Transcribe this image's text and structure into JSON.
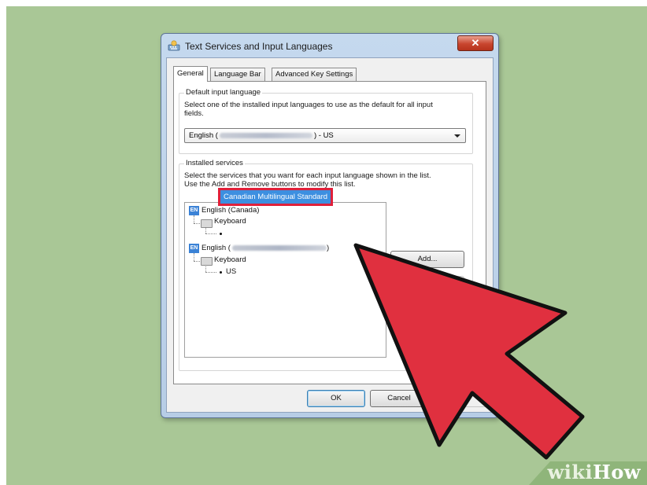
{
  "dialog": {
    "title": "Text Services and Input Languages",
    "close_label": "✕"
  },
  "tabs": [
    {
      "label": "General",
      "active": true
    },
    {
      "label": "Language Bar",
      "active": false
    },
    {
      "label": "Advanced Key Settings",
      "active": false
    }
  ],
  "default_input": {
    "heading": "Default input language",
    "description_line1": "Select one of the installed input languages to use as the default for all input",
    "description_line2": "fields.",
    "combo_prefix": "English (",
    "combo_suffix": ") - US"
  },
  "installed_services": {
    "heading": "Installed services",
    "description_line1": "Select the services that you want for each input language shown in the list.",
    "description_line2": "Use the Add and Remove buttons to modify this list.",
    "tree": {
      "lang1_badge": "EN",
      "lang1_label": "English (Canada)",
      "lang1_keyboard": "Keyboard",
      "lang1_layout": "Canadian Multilingual Standard",
      "lang2_badge": "EN",
      "lang2_label": "English (",
      "lang2_suffix": ")",
      "lang2_keyboard": "Keyboard",
      "lang2_layout": "US"
    },
    "add_button": "Add..."
  },
  "footer": {
    "ok_label": "OK",
    "cancel_label": "Cancel"
  },
  "watermark": {
    "part1": "wiki",
    "part2": "How"
  },
  "colors": {
    "background": "#a9c796",
    "highlight_border": "#e0203a",
    "selection": "#3d8fe0",
    "pointer_arrow": "#e0303f"
  }
}
